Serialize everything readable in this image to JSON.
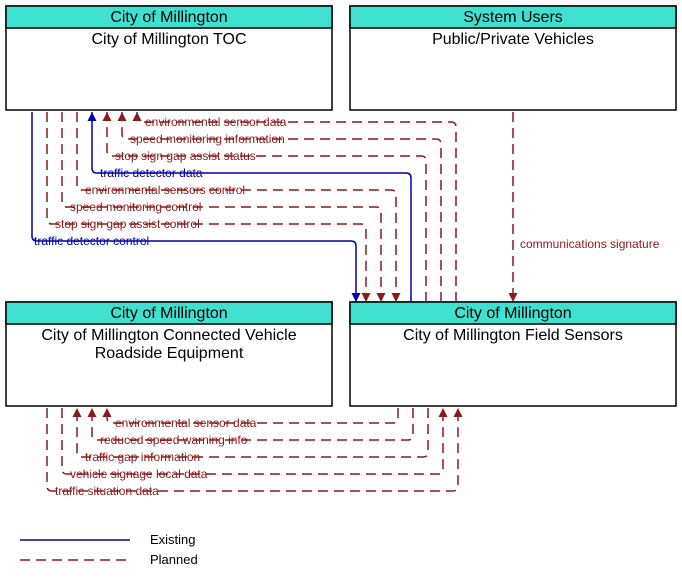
{
  "nodes": {
    "top_left": {
      "owner": "City of Millington",
      "name": "City of Millington TOC"
    },
    "top_right": {
      "owner": "System Users",
      "name": "Public/Private Vehicles"
    },
    "bottom_left": {
      "owner": "City of Millington",
      "name": "City of Millington Connected Vehicle",
      "name2": "Roadside Equipment"
    },
    "bottom_right": {
      "owner": "City of Millington",
      "name": "City of Millington Field Sensors"
    }
  },
  "flows_top": [
    {
      "label": "environmental sensor data",
      "style": "planned"
    },
    {
      "label": "speed monitoring information",
      "style": "planned"
    },
    {
      "label": "stop sign gap assist status",
      "style": "planned"
    },
    {
      "label": "traffic detector data",
      "style": "existing"
    },
    {
      "label": "environmental sensors control",
      "style": "planned"
    },
    {
      "label": "speed monitoring control",
      "style": "planned"
    },
    {
      "label": "stop sign gap assist control",
      "style": "planned"
    },
    {
      "label": "traffic detector control",
      "style": "existing"
    }
  ],
  "flow_right": {
    "label": "communications signature",
    "style": "planned"
  },
  "flows_bottom": [
    {
      "label": "environmental sensor data",
      "style": "planned"
    },
    {
      "label": "reduced speed warning info",
      "style": "planned"
    },
    {
      "label": "traffic gap information",
      "style": "planned"
    },
    {
      "label": "vehicle signage local data",
      "style": "planned"
    },
    {
      "label": "traffic situation data",
      "style": "planned"
    }
  ],
  "legend": {
    "existing": "Existing",
    "planned": "Planned"
  }
}
